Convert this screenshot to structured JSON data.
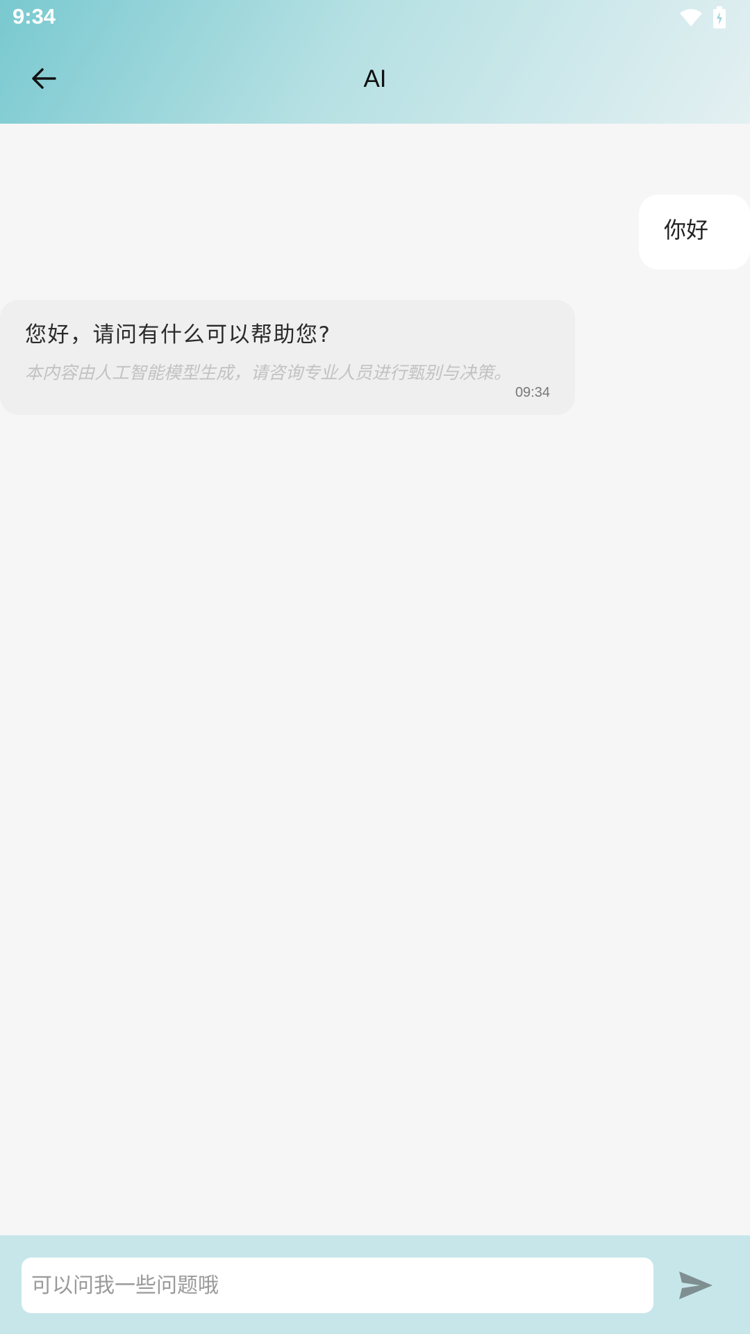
{
  "status_bar": {
    "time": "9:34",
    "icons": [
      "wifi-icon",
      "battery-charging-icon"
    ]
  },
  "header": {
    "title": "AI",
    "back_icon": "arrow-left-icon"
  },
  "messages": [
    {
      "role": "user",
      "text": "你好"
    },
    {
      "role": "assistant",
      "text": "您好，请问有什么可以帮助您?",
      "disclaimer": "本内容由人工智能模型生成，请咨询专业人员进行甄别与决策。",
      "time": "09:34"
    }
  ],
  "input": {
    "placeholder": "可以问我一些问题哦",
    "value": "",
    "send_icon": "send-icon"
  },
  "colors": {
    "header_gradient_start": "#79c9d0",
    "header_gradient_end": "#e4f0f2",
    "chat_background": "#f6f6f6",
    "user_bubble": "#ffffff",
    "assistant_bubble": "#efefef",
    "input_bar": "#c6e6ea",
    "send_icon": "#7f8f91"
  }
}
